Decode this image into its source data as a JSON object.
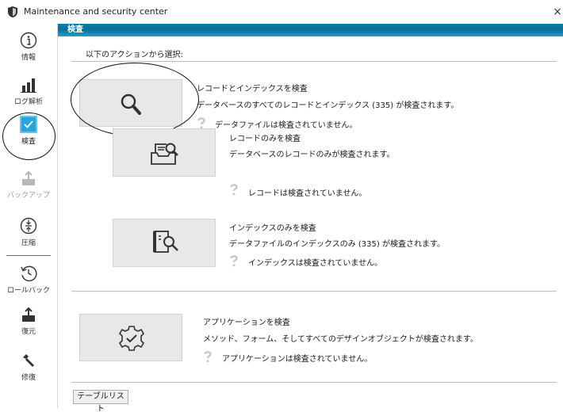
{
  "window": {
    "title": "Maintenance and security center",
    "close": "×"
  },
  "sidebar": {
    "items": [
      {
        "label": "情報",
        "icon": "info-icon"
      },
      {
        "label": "ログ解析",
        "icon": "bar-chart-icon"
      },
      {
        "label": "検査",
        "icon": "checkbox-icon",
        "active": true
      },
      {
        "label": "バックアップ",
        "icon": "backup-icon",
        "disabled": true
      },
      {
        "label": "圧縮",
        "icon": "compress-icon"
      },
      {
        "label": "ロールバック",
        "icon": "rollback-icon"
      },
      {
        "label": "復元",
        "icon": "restore-icon"
      },
      {
        "label": "修復",
        "icon": "repair-icon"
      }
    ]
  },
  "main": {
    "header": "検査",
    "subtitle": "以下のアクションから選択:",
    "actions": [
      {
        "title": "レコードとインデックスを検査",
        "description": "データベースのすべてのレコードとインデックス (335) が検査されます。",
        "status": "データファイルは検査されていません。",
        "icon": "magnifier-icon"
      },
      {
        "title": "レコードのみを検査",
        "description": "データベースのレコードのみが検査されます。",
        "status": "レコードは検査されていません。",
        "icon": "records-search-icon"
      },
      {
        "title": "インデックスのみを検査",
        "description": "データファイルのインデックスのみ (335) が検査されます。",
        "status": "インデックスは検査されていません。",
        "icon": "index-search-icon"
      },
      {
        "title": "アプリケーションを検査",
        "description": "メソッド、フォーム、そしてすべてのデザインオブジェクトが検査されます。",
        "status": "アプリケーションは検査されていません。",
        "icon": "gear-check-icon"
      }
    ],
    "table_list_button": "テーブルリスト"
  },
  "colors": {
    "header_blue": "#0a6f96",
    "accent": "#29a3dc",
    "button_gray": "#e8e8e8"
  }
}
